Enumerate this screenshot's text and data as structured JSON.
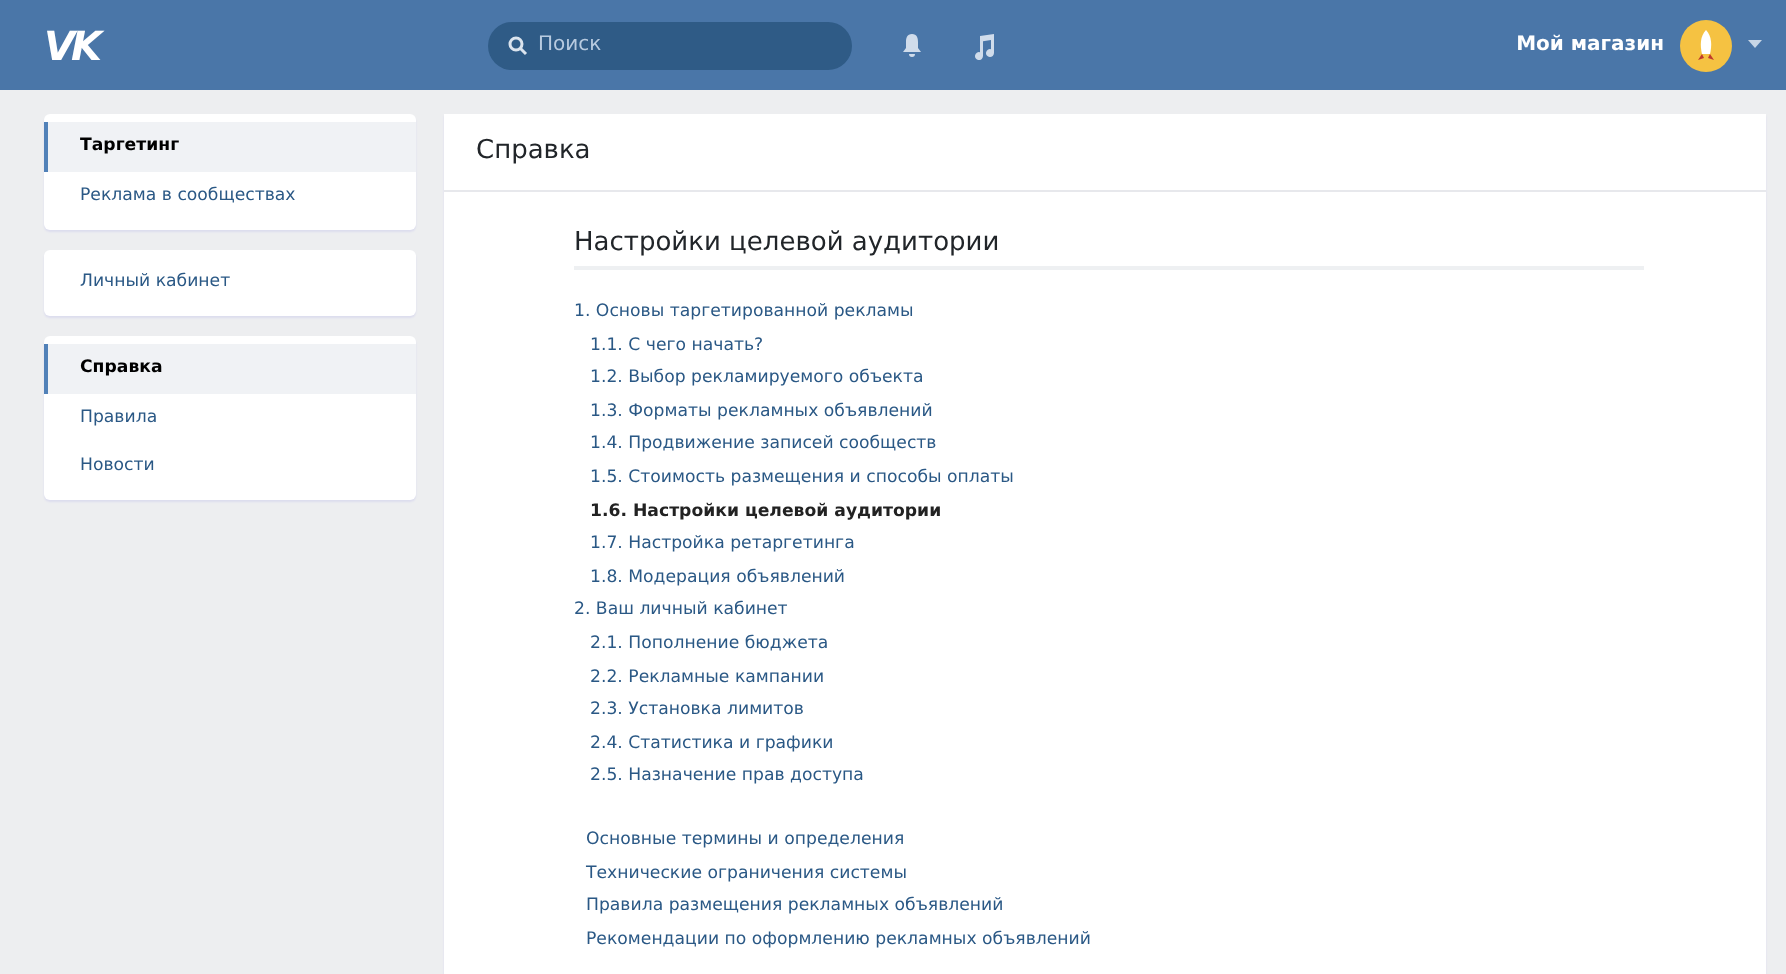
{
  "header": {
    "logo": "VK",
    "search": {
      "placeholder": "Поиск"
    },
    "user_name": "Мой магазин"
  },
  "sidebar": {
    "groups": [
      {
        "items": [
          {
            "label": "Таргетинг",
            "selected": true
          },
          {
            "label": "Реклама в сообществах",
            "selected": false
          }
        ]
      },
      {
        "items": [
          {
            "label": "Личный кабинет",
            "selected": false
          }
        ]
      },
      {
        "items": [
          {
            "label": "Справка",
            "selected": true
          },
          {
            "label": "Правила",
            "selected": false
          },
          {
            "label": "Новости",
            "selected": false
          }
        ]
      }
    ]
  },
  "content": {
    "title": "Справка",
    "heading": "Настройки целевой аудитории",
    "toc": [
      {
        "label": "1. Основы таргетированной рекламы",
        "selected": false,
        "children": [
          {
            "label": "1.1. С чего начать?",
            "selected": false
          },
          {
            "label": "1.2. Выбор рекламируемого объекта",
            "selected": false
          },
          {
            "label": "1.3. Форматы рекламных объявлений",
            "selected": false
          },
          {
            "label": "1.4. Продвижение записей сообществ",
            "selected": false
          },
          {
            "label": "1.5. Стоимость размещения и способы оплаты",
            "selected": false
          },
          {
            "label": "1.6. Настройки целевой аудитории",
            "selected": true
          },
          {
            "label": "1.7. Настройка ретаргетинга",
            "selected": false
          },
          {
            "label": "1.8. Модерация объявлений",
            "selected": false
          }
        ]
      },
      {
        "label": "2. Ваш личный кабинет",
        "selected": false,
        "children": [
          {
            "label": "2.1. Пополнение бюджета",
            "selected": false
          },
          {
            "label": "2.2. Рекламные кампании",
            "selected": false
          },
          {
            "label": "2.3. Установка лимитов",
            "selected": false
          },
          {
            "label": "2.4. Статистика и графики",
            "selected": false
          },
          {
            "label": "2.5. Назначение прав доступа",
            "selected": false
          }
        ]
      }
    ],
    "extra_links": [
      "Основные термины и определения",
      "Технические ограничения системы",
      "Правила размещения рекламных объявлений",
      "Рекомендации по оформлению рекламных объявлений"
    ]
  }
}
